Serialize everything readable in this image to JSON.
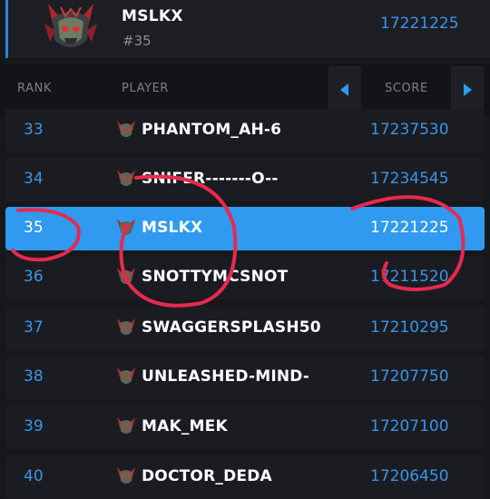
{
  "me": {
    "name": "MSLKX",
    "rank": "#35",
    "score": "17221225"
  },
  "header": {
    "rank": "RANK",
    "player": "PLAYER",
    "score": "SCORE"
  },
  "rows": [
    {
      "rank": "33",
      "name": "PHANTOM_AH-6",
      "score": "17237530"
    },
    {
      "rank": "34",
      "name": "SNIFER-------O--",
      "score": "17234545"
    },
    {
      "rank": "35",
      "name": "MSLKX",
      "score": "17221225"
    },
    {
      "rank": "36",
      "name": "SNOTTYMCSNOT",
      "score": "17211520"
    },
    {
      "rank": "37",
      "name": "SWAGGERSPLASH50",
      "score": "17210295"
    },
    {
      "rank": "38",
      "name": "UNLEASHED-MIND-",
      "score": "17207750"
    },
    {
      "rank": "39",
      "name": "MAK_MEK",
      "score": "17207100"
    },
    {
      "rank": "40",
      "name": "DOCTOR_DEDA",
      "score": "17206450"
    }
  ],
  "colors": {
    "accent": "#3a95e8",
    "highlight_row": "#2f9af0",
    "annotation": "#e8294f"
  },
  "icons": {
    "avatar": "demon-skull-emblem-icon",
    "prev": "chevron-left-icon",
    "next": "chevron-right-icon"
  }
}
